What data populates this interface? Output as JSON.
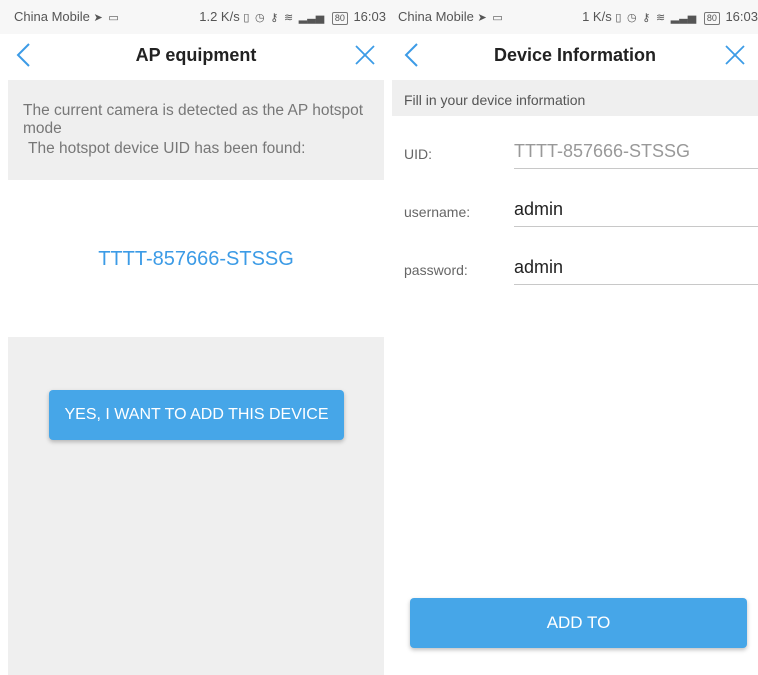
{
  "colors": {
    "accent": "#46a6e8",
    "link_blue": "#3c9be6",
    "panel_gray": "#efefef"
  },
  "left": {
    "status": {
      "carrier": "China Mobile",
      "speed": "1.2 K/s",
      "battery": "80",
      "time": "16:03"
    },
    "title": "AP equipment",
    "message_line1": "The current camera is detected as the AP hotspot mode",
    "message_line2": "The hotspot device UID has been found:",
    "uid": "TTTT-857666-STSSG",
    "confirm_button": "YES, I WANT TO ADD THIS DEVICE"
  },
  "right": {
    "status": {
      "carrier": "China Mobile",
      "speed": "1 K/s",
      "battery": "80",
      "time": "16:03"
    },
    "title": "Device Information",
    "section_label": "Fill in your device information",
    "fields": [
      {
        "label": "UID:",
        "value": "TTTT-857666-STSSG"
      },
      {
        "label": "username:",
        "value": "admin"
      },
      {
        "label": "password:",
        "value": "admin"
      }
    ],
    "add_button": "ADD TO"
  },
  "icons": [
    "back-arrow-icon",
    "close-icon",
    "location-arrow-icon",
    "laptop-icon",
    "vibrate-icon",
    "alarm-icon",
    "key-icon",
    "wifi-icon",
    "signal-icon",
    "battery-icon"
  ]
}
